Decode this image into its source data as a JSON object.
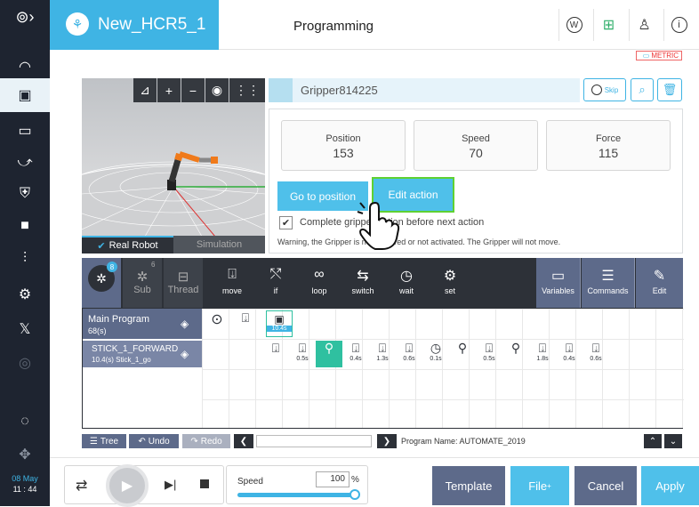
{
  "header": {
    "project_name": "New_HCR5_1",
    "page_title": "Programming",
    "units_badge": "METRIC"
  },
  "clock": {
    "date": "08 May",
    "time": "11 : 44"
  },
  "viewer": {
    "tabs": [
      {
        "label": "Real Robot",
        "active": true
      },
      {
        "label": "Simulation",
        "active": false
      }
    ]
  },
  "action": {
    "name": "Gripper814225",
    "skip_label": "Skip",
    "stats": [
      {
        "label": "Position",
        "value": "153"
      },
      {
        "label": "Speed",
        "value": "70"
      },
      {
        "label": "Force",
        "value": "115"
      }
    ],
    "buttons": {
      "goto": "Go to position",
      "edit": "Edit action"
    },
    "checkbox_label": "Complete gripper action before next action",
    "checkbox_checked": true,
    "warning": "Warning, the Gripper is not powered or not activated. The Gripper will not move."
  },
  "palette": {
    "tabs": [
      {
        "label": "",
        "badge": "8",
        "active": true
      },
      {
        "label": "Sub",
        "badge": "6"
      },
      {
        "label": "Thread",
        "badge": ""
      }
    ],
    "items": [
      "move",
      "if",
      "loop",
      "switch",
      "wait",
      "set"
    ],
    "right_items": [
      "Variables",
      "Commands",
      "Edit"
    ]
  },
  "program": {
    "rows": [
      {
        "name": "Main Program",
        "sub": "68(s)"
      },
      {
        "name": "STICK_1_FORWARD",
        "sub": "10.4(s) Stick_1_go"
      }
    ],
    "main_cells": [
      "",
      "",
      "10.4s"
    ],
    "stick_cells": [
      "",
      "0.5s",
      "",
      "0.4s",
      "1.3s",
      "0.6s",
      "0.1s",
      "",
      "0.5s",
      "",
      "1.8s",
      "0.4s",
      "0.6s"
    ]
  },
  "footer": {
    "tree": "Tree",
    "undo": "Undo",
    "redo": "Redo",
    "program_name": "Program Name: AUTOMATE_2019"
  },
  "bottom": {
    "speed_label": "Speed",
    "speed_value": "100",
    "speed_unit": "%",
    "speed_fraction": 1.0,
    "template": "Template",
    "file": "File",
    "cancel": "Cancel",
    "apply": "Apply"
  },
  "colors": {
    "accent": "#3fb4e4",
    "dark": "#1e2430",
    "palette": "#2d3138",
    "highlight": "#2fc0a0",
    "focus_border": "#5fd132"
  }
}
